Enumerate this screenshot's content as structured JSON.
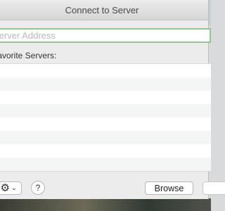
{
  "window": {
    "title": "Connect to Server"
  },
  "address": {
    "placeholder": "Server Address",
    "value": ""
  },
  "list": {
    "header": "Favorite Servers:",
    "rows": 8
  },
  "footer": {
    "gear_icon": "gear-icon",
    "chevron_icon": "chevron-down-icon",
    "help_label": "?",
    "browse_label": "Browse"
  }
}
